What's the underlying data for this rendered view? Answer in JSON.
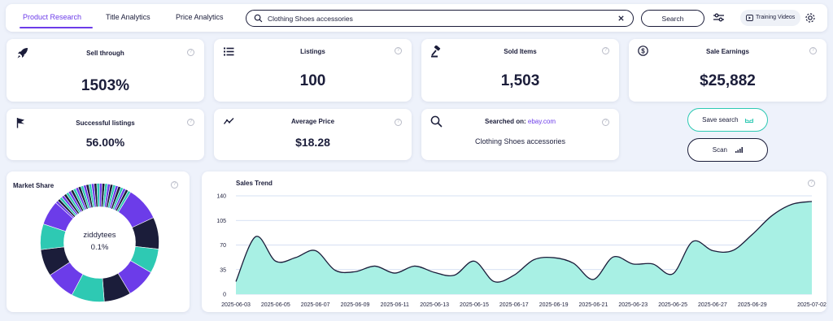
{
  "nav": {
    "tabs": [
      {
        "label": "Product Research",
        "active": true
      },
      {
        "label": "Title Analytics",
        "active": false
      },
      {
        "label": "Price Analytics",
        "active": false
      }
    ],
    "search": {
      "value": "Clothing Shoes accessories"
    },
    "search_button": "Search",
    "training_button": "Training Videos",
    "icons": [
      "search-icon",
      "clear-icon",
      "filter-icon",
      "play-icon",
      "gear-icon"
    ]
  },
  "stats": {
    "sell_through": {
      "title": "Sell through",
      "value": "1503%"
    },
    "listings": {
      "title": "Listings",
      "value": "100"
    },
    "sold_items": {
      "title": "Sold Items",
      "value": "1,503"
    },
    "sale_earnings": {
      "title": "Sale Earnings",
      "value": "$25,882"
    },
    "successful_listings": {
      "title": "Successful listings",
      "value": "56.00%"
    },
    "average_price": {
      "title": "Average Price",
      "value": "$18.28"
    },
    "searched_on": {
      "title": "Searched on:",
      "site": "ebay.com",
      "query": "Clothing Shoes accessories"
    }
  },
  "actions": {
    "save_search": "Save search",
    "scan": "Scan"
  },
  "market_share": {
    "title": "Market Share",
    "center_label": "ziddytees",
    "center_value": "0.1%"
  },
  "colors": {
    "accent": "#6c3ce9",
    "teal": "#2ec9b3",
    "navy": "#1b1d3a",
    "area_fill": "#a8f0e4"
  },
  "chart_data": {
    "type": "area",
    "title": "Sales Trend",
    "ylim": [
      0,
      140
    ],
    "yticks": [
      0,
      35,
      70,
      105,
      140
    ],
    "xticks": [
      "2025-06-03",
      "2025-06-05",
      "2025-06-07",
      "2025-06-09",
      "2025-06-11",
      "2025-06-13",
      "2025-06-15",
      "2025-06-17",
      "2025-06-19",
      "2025-06-21",
      "2025-06-23",
      "2025-06-25",
      "2025-06-27",
      "2025-06-29",
      "2025-07-02"
    ],
    "x": [
      "2025-06-03",
      "2025-06-04",
      "2025-06-05",
      "2025-06-06",
      "2025-06-07",
      "2025-06-08",
      "2025-06-09",
      "2025-06-10",
      "2025-06-11",
      "2025-06-12",
      "2025-06-13",
      "2025-06-14",
      "2025-06-15",
      "2025-06-16",
      "2025-06-17",
      "2025-06-18",
      "2025-06-19",
      "2025-06-20",
      "2025-06-21",
      "2025-06-22",
      "2025-06-23",
      "2025-06-24",
      "2025-06-25",
      "2025-06-26",
      "2025-06-27",
      "2025-06-28",
      "2025-06-29",
      "2025-06-30",
      "2025-07-01",
      "2025-07-02"
    ],
    "values": [
      18,
      82,
      47,
      52,
      62,
      34,
      32,
      40,
      30,
      40,
      31,
      27,
      47,
      18,
      27,
      49,
      52,
      44,
      21,
      53,
      43,
      43,
      29,
      75,
      62,
      62,
      85,
      112,
      128,
      132
    ],
    "grid": true
  }
}
